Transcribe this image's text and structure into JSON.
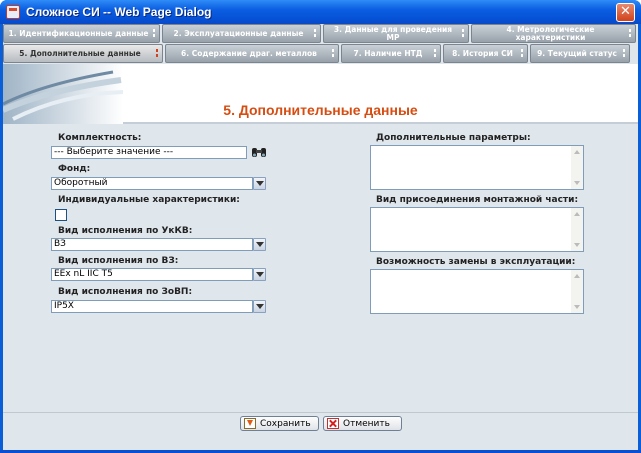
{
  "window": {
    "title": "Сложное СИ -- Web Page Dialog",
    "close_glyph": "✕"
  },
  "tabs_row1": [
    {
      "label": "1. Идентификационные данные"
    },
    {
      "label": "2. Эксплуатационные данные"
    },
    {
      "label": "3. Данные для проведения МР"
    },
    {
      "label": "4. Метрологические характеристики"
    }
  ],
  "tabs_row2": [
    {
      "label": "5. Дополнительные данные",
      "active": true
    },
    {
      "label": "6. Содержание драг. металлов"
    },
    {
      "label": "7. Наличие НТД"
    },
    {
      "label": "8. История СИ"
    },
    {
      "label": "9. Текущий статус"
    }
  ],
  "page_title": "5. Дополнительные данные",
  "form": {
    "komplektnost": {
      "label": "Комплектность:",
      "value": "--- Выберите значение ---",
      "icon": "binoculars-icon"
    },
    "fond": {
      "label": "Фонд:",
      "value": "Оборотный"
    },
    "individual": {
      "label": "Индивидуальные характеристики:",
      "checked": false
    },
    "ukkv": {
      "label": "Вид исполнения по УкКВ:",
      "value": "ВЗ"
    },
    "vz": {
      "label": "Вид исполнения по ВЗ:",
      "value": "EEx nL IIC T5"
    },
    "zovp": {
      "label": "Вид исполнения по ЗоВП:",
      "value": "IP5X"
    },
    "extra_params": {
      "label": "Дополнительные параметры:",
      "value": ""
    },
    "mount_type": {
      "label": "Вид присоединения монтажной части:",
      "value": ""
    },
    "replace": {
      "label": "Возможность замены в эксплуатации:",
      "value": ""
    }
  },
  "buttons": {
    "save": "Сохранить",
    "cancel": "Отменить"
  },
  "colors": {
    "title_bar": "#0b5ee1",
    "accent_title": "#d64d12",
    "panel_bg": "#dfe6ec"
  }
}
